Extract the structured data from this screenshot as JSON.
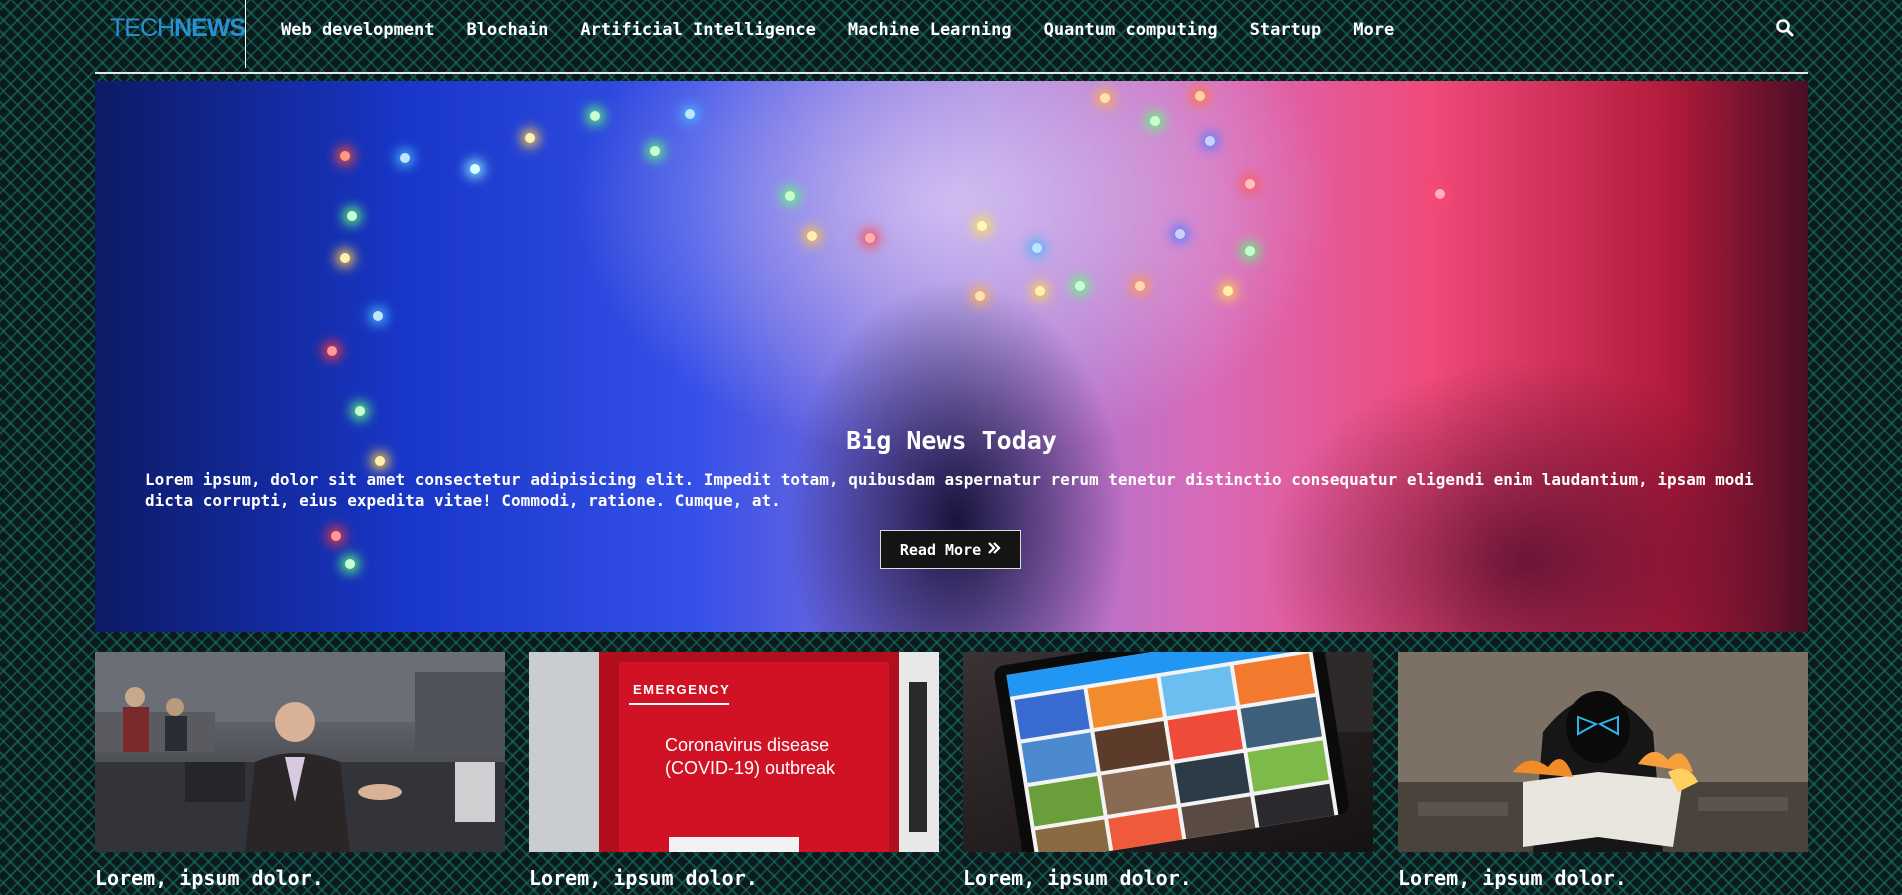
{
  "brand": {
    "part1": "TECH",
    "part2": "NEWS"
  },
  "nav": {
    "items": [
      "Web development",
      "Blochain",
      "Artificial Intelligence",
      "Machine Learning",
      "Quantum computing",
      "Startup",
      "More"
    ]
  },
  "search": {
    "icon": "search-icon"
  },
  "hero": {
    "title": "Big News Today",
    "text": "Lorem ipsum, dolor sit amet consectetur adipisicing elit. Impedit totam, quibusdam aspernatur rerum tenetur distinctio consequatur eligendi enim laudantium, ipsam modi dicta corrupti, eius expedita vitae! Commodi, ratione. Cumque, at.",
    "button_label": "Read More",
    "button_icon": "double-chevron-right-icon"
  },
  "cards": [
    {
      "title": "Lorem, ipsum dolor."
    },
    {
      "title": "Lorem, ipsum dolor.",
      "sign_header": "EMERGENCY",
      "sign_text": "Coronavirus disease (COVID-19) outbreak"
    },
    {
      "title": "Lorem, ipsum dolor."
    },
    {
      "title": "Lorem, ipsum dolor."
    }
  ],
  "colors": {
    "accent": "#2a8fd0",
    "background": "#0c1a1b",
    "button_bg": "#141414"
  }
}
